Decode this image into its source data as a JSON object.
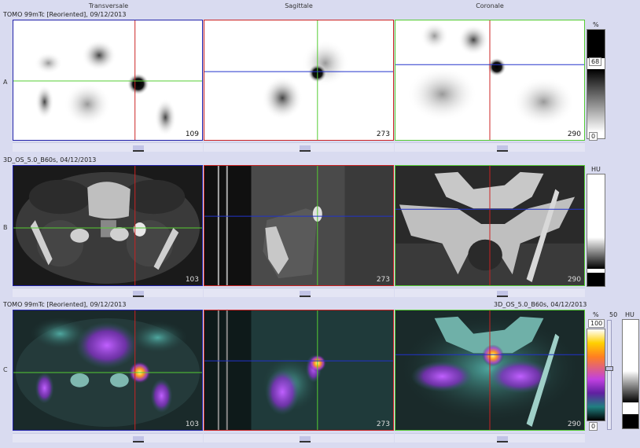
{
  "columns": {
    "transversale": "Transversale",
    "sagittale": "Sagittale",
    "coronale": "Coronale"
  },
  "rows": {
    "a": {
      "letter": "A",
      "title": "TOMO 99mTc [Reoriented], 09/12/2013",
      "slices": [
        "109",
        "273",
        "290"
      ]
    },
    "b": {
      "letter": "B",
      "title": "3D_OS_5.0_B60s, 04/12/2013",
      "slices": [
        "103",
        "273",
        "290"
      ]
    },
    "c": {
      "letter": "C",
      "title_left": "TOMO 99mTc [Reoriented], 09/12/2013",
      "title_right": "3D_OS_5.0_B60s, 04/12/2013",
      "slices": [
        "103",
        "273",
        "290"
      ]
    }
  },
  "scales": {
    "a": {
      "unit": "%",
      "level": "68",
      "min": "0"
    },
    "b": {
      "unit": "HU"
    },
    "c": {
      "unit_pct": "%",
      "max": "100",
      "min": "0",
      "level": "50",
      "unit_hu": "HU"
    }
  },
  "colors": {
    "sagittal_frame": "#cc2222",
    "coronal_frame": "#22aa22",
    "transverse_frame": "#2222aa",
    "crosshair_v": "#cc2222",
    "crosshair_h_green": "#55cc33",
    "crosshair_h_blue": "#2233cc"
  }
}
